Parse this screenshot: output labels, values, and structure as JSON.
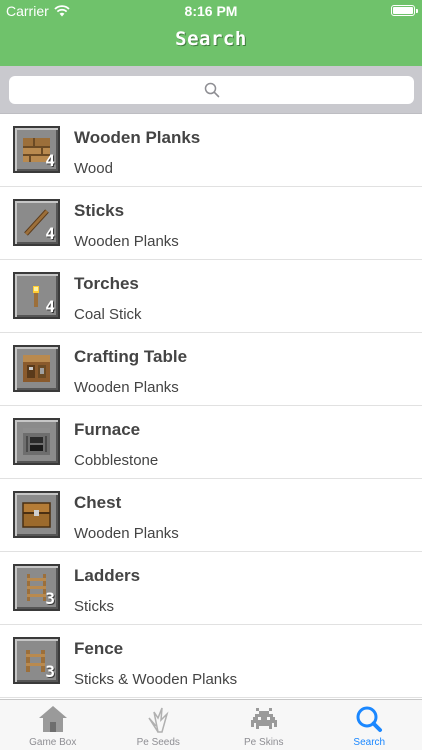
{
  "status_bar": {
    "carrier": "Carrier",
    "time": "8:16 PM"
  },
  "nav": {
    "title": "Search"
  },
  "search": {
    "placeholder": "",
    "value": ""
  },
  "items": [
    {
      "title": "Wooden Planks",
      "subtitle": "Wood",
      "qty": "4",
      "icon": "wooden-planks-icon"
    },
    {
      "title": "Sticks",
      "subtitle": "Wooden Planks",
      "qty": "4",
      "icon": "stick-icon"
    },
    {
      "title": "Torches",
      "subtitle": "Coal Stick",
      "qty": "4",
      "icon": "torch-icon"
    },
    {
      "title": "Crafting Table",
      "subtitle": "Wooden Planks",
      "qty": "",
      "icon": "crafting-table-icon"
    },
    {
      "title": "Furnace",
      "subtitle": "Cobblestone",
      "qty": "",
      "icon": "furnace-icon"
    },
    {
      "title": "Chest",
      "subtitle": "Wooden Planks",
      "qty": "",
      "icon": "chest-icon"
    },
    {
      "title": "Ladders",
      "subtitle": "Sticks",
      "qty": "3",
      "icon": "ladder-icon"
    },
    {
      "title": "Fence",
      "subtitle": "Sticks & Wooden Planks",
      "qty": "3",
      "icon": "fence-icon"
    }
  ],
  "tabs": [
    {
      "label": "Game Box",
      "icon": "house-icon",
      "active": false
    },
    {
      "label": "Pe Seeds",
      "icon": "plant-icon",
      "active": false
    },
    {
      "label": "Pe Skins",
      "icon": "space-invader-icon",
      "active": false
    },
    {
      "label": "Search",
      "icon": "search-icon",
      "active": true
    }
  ],
  "colors": {
    "header_green": "#6fc26b",
    "active_tab": "#1a87ff",
    "inactive_tab": "#8e8e93"
  }
}
